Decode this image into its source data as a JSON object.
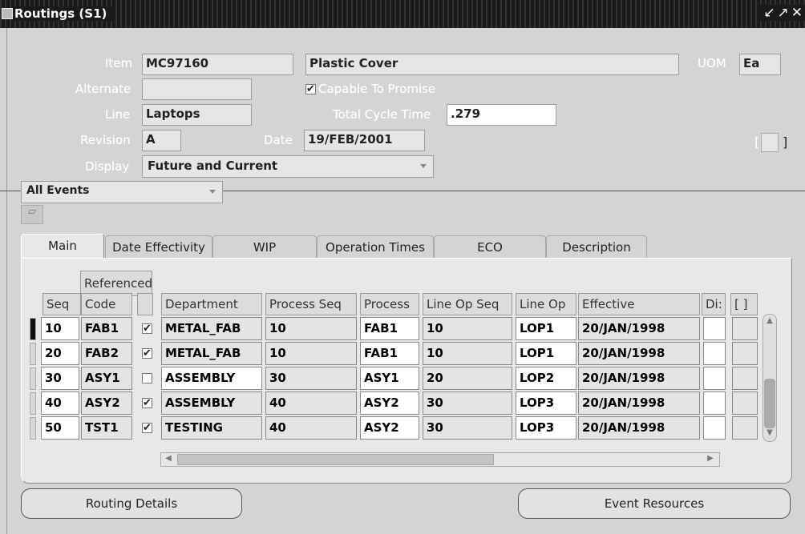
{
  "title": "Routings (S1)",
  "window_controls": [
    "↙",
    "↗",
    "✕"
  ],
  "header": {
    "item_label": "Item",
    "item_value": "MC97160",
    "item_desc": "Plastic Cover",
    "uom_label": "UOM",
    "uom_value": "Ea",
    "alternate_label": "Alternate",
    "alternate_value": "",
    "ctp_label": "Capable To Promise",
    "ctp_checked": true,
    "line_label": "Line",
    "line_value": "Laptops",
    "cycle_label": "Total Cycle Time",
    "cycle_value": ".279",
    "revision_label": "Revision",
    "revision_value": "A",
    "date_label": "Date",
    "date_value": "19/FEB/2001",
    "display_label": "Display",
    "display_value": "Future and Current",
    "bracket_field": "[",
    "bracket_field_close": "]"
  },
  "events_select": "All Events",
  "tabs": [
    "Main",
    "Date Effectivity",
    "WIP",
    "Operation Times",
    "ECO",
    "Description"
  ],
  "active_tab": "Main",
  "table": {
    "group_header": "Referenced",
    "columns": [
      "Seq",
      "Code",
      "",
      "Department",
      "Process Seq",
      "Process",
      "Line Op Seq",
      "Line Op",
      "Effective",
      "Di:",
      "[ ]"
    ],
    "rows": [
      {
        "seq": "10",
        "code": "FAB1",
        "referenced": true,
        "department": "METAL_FAB",
        "process_seq": "10",
        "process": "FAB1",
        "line_op_seq": "10",
        "line_op": "LOP1",
        "effective": "20/JAN/1998"
      },
      {
        "seq": "20",
        "code": "FAB2",
        "referenced": true,
        "department": "METAL_FAB",
        "process_seq": "10",
        "process": "FAB1",
        "line_op_seq": "10",
        "line_op": "LOP1",
        "effective": "20/JAN/1998"
      },
      {
        "seq": "30",
        "code": "ASY1",
        "referenced": false,
        "department": "ASSEMBLY",
        "process_seq": "30",
        "process": "ASY1",
        "line_op_seq": "20",
        "line_op": "LOP2",
        "effective": "20/JAN/1998"
      },
      {
        "seq": "40",
        "code": "ASY2",
        "referenced": true,
        "department": "ASSEMBLY",
        "process_seq": "40",
        "process": "ASY2",
        "line_op_seq": "30",
        "line_op": "LOP3",
        "effective": "20/JAN/1998"
      },
      {
        "seq": "50",
        "code": "TST1",
        "referenced": true,
        "department": "TESTING",
        "process_seq": "40",
        "process": "ASY2",
        "line_op_seq": "30",
        "line_op": "LOP3",
        "effective": "20/JAN/1998"
      }
    ]
  },
  "buttons": {
    "routing_details": "Routing Details",
    "event_resources": "Event Resources"
  }
}
